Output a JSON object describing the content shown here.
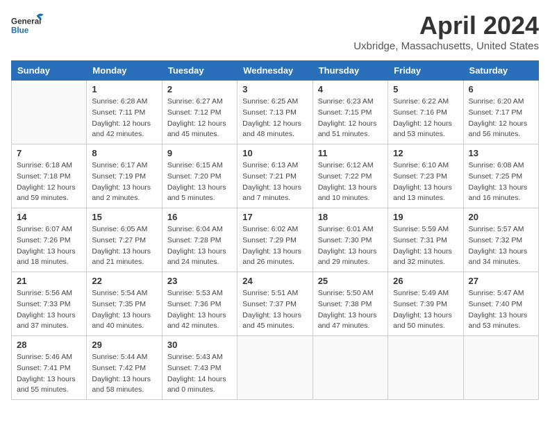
{
  "header": {
    "logo_general": "General",
    "logo_blue": "Blue",
    "month": "April 2024",
    "location": "Uxbridge, Massachusetts, United States"
  },
  "weekdays": [
    "Sunday",
    "Monday",
    "Tuesday",
    "Wednesday",
    "Thursday",
    "Friday",
    "Saturday"
  ],
  "weeks": [
    [
      {
        "day": "",
        "sunrise": "",
        "sunset": "",
        "daylight": ""
      },
      {
        "day": "1",
        "sunrise": "Sunrise: 6:28 AM",
        "sunset": "Sunset: 7:11 PM",
        "daylight": "Daylight: 12 hours and 42 minutes."
      },
      {
        "day": "2",
        "sunrise": "Sunrise: 6:27 AM",
        "sunset": "Sunset: 7:12 PM",
        "daylight": "Daylight: 12 hours and 45 minutes."
      },
      {
        "day": "3",
        "sunrise": "Sunrise: 6:25 AM",
        "sunset": "Sunset: 7:13 PM",
        "daylight": "Daylight: 12 hours and 48 minutes."
      },
      {
        "day": "4",
        "sunrise": "Sunrise: 6:23 AM",
        "sunset": "Sunset: 7:15 PM",
        "daylight": "Daylight: 12 hours and 51 minutes."
      },
      {
        "day": "5",
        "sunrise": "Sunrise: 6:22 AM",
        "sunset": "Sunset: 7:16 PM",
        "daylight": "Daylight: 12 hours and 53 minutes."
      },
      {
        "day": "6",
        "sunrise": "Sunrise: 6:20 AM",
        "sunset": "Sunset: 7:17 PM",
        "daylight": "Daylight: 12 hours and 56 minutes."
      }
    ],
    [
      {
        "day": "7",
        "sunrise": "Sunrise: 6:18 AM",
        "sunset": "Sunset: 7:18 PM",
        "daylight": "Daylight: 12 hours and 59 minutes."
      },
      {
        "day": "8",
        "sunrise": "Sunrise: 6:17 AM",
        "sunset": "Sunset: 7:19 PM",
        "daylight": "Daylight: 13 hours and 2 minutes."
      },
      {
        "day": "9",
        "sunrise": "Sunrise: 6:15 AM",
        "sunset": "Sunset: 7:20 PM",
        "daylight": "Daylight: 13 hours and 5 minutes."
      },
      {
        "day": "10",
        "sunrise": "Sunrise: 6:13 AM",
        "sunset": "Sunset: 7:21 PM",
        "daylight": "Daylight: 13 hours and 7 minutes."
      },
      {
        "day": "11",
        "sunrise": "Sunrise: 6:12 AM",
        "sunset": "Sunset: 7:22 PM",
        "daylight": "Daylight: 13 hours and 10 minutes."
      },
      {
        "day": "12",
        "sunrise": "Sunrise: 6:10 AM",
        "sunset": "Sunset: 7:23 PM",
        "daylight": "Daylight: 13 hours and 13 minutes."
      },
      {
        "day": "13",
        "sunrise": "Sunrise: 6:08 AM",
        "sunset": "Sunset: 7:25 PM",
        "daylight": "Daylight: 13 hours and 16 minutes."
      }
    ],
    [
      {
        "day": "14",
        "sunrise": "Sunrise: 6:07 AM",
        "sunset": "Sunset: 7:26 PM",
        "daylight": "Daylight: 13 hours and 18 minutes."
      },
      {
        "day": "15",
        "sunrise": "Sunrise: 6:05 AM",
        "sunset": "Sunset: 7:27 PM",
        "daylight": "Daylight: 13 hours and 21 minutes."
      },
      {
        "day": "16",
        "sunrise": "Sunrise: 6:04 AM",
        "sunset": "Sunset: 7:28 PM",
        "daylight": "Daylight: 13 hours and 24 minutes."
      },
      {
        "day": "17",
        "sunrise": "Sunrise: 6:02 AM",
        "sunset": "Sunset: 7:29 PM",
        "daylight": "Daylight: 13 hours and 26 minutes."
      },
      {
        "day": "18",
        "sunrise": "Sunrise: 6:01 AM",
        "sunset": "Sunset: 7:30 PM",
        "daylight": "Daylight: 13 hours and 29 minutes."
      },
      {
        "day": "19",
        "sunrise": "Sunrise: 5:59 AM",
        "sunset": "Sunset: 7:31 PM",
        "daylight": "Daylight: 13 hours and 32 minutes."
      },
      {
        "day": "20",
        "sunrise": "Sunrise: 5:57 AM",
        "sunset": "Sunset: 7:32 PM",
        "daylight": "Daylight: 13 hours and 34 minutes."
      }
    ],
    [
      {
        "day": "21",
        "sunrise": "Sunrise: 5:56 AM",
        "sunset": "Sunset: 7:33 PM",
        "daylight": "Daylight: 13 hours and 37 minutes."
      },
      {
        "day": "22",
        "sunrise": "Sunrise: 5:54 AM",
        "sunset": "Sunset: 7:35 PM",
        "daylight": "Daylight: 13 hours and 40 minutes."
      },
      {
        "day": "23",
        "sunrise": "Sunrise: 5:53 AM",
        "sunset": "Sunset: 7:36 PM",
        "daylight": "Daylight: 13 hours and 42 minutes."
      },
      {
        "day": "24",
        "sunrise": "Sunrise: 5:51 AM",
        "sunset": "Sunset: 7:37 PM",
        "daylight": "Daylight: 13 hours and 45 minutes."
      },
      {
        "day": "25",
        "sunrise": "Sunrise: 5:50 AM",
        "sunset": "Sunset: 7:38 PM",
        "daylight": "Daylight: 13 hours and 47 minutes."
      },
      {
        "day": "26",
        "sunrise": "Sunrise: 5:49 AM",
        "sunset": "Sunset: 7:39 PM",
        "daylight": "Daylight: 13 hours and 50 minutes."
      },
      {
        "day": "27",
        "sunrise": "Sunrise: 5:47 AM",
        "sunset": "Sunset: 7:40 PM",
        "daylight": "Daylight: 13 hours and 53 minutes."
      }
    ],
    [
      {
        "day": "28",
        "sunrise": "Sunrise: 5:46 AM",
        "sunset": "Sunset: 7:41 PM",
        "daylight": "Daylight: 13 hours and 55 minutes."
      },
      {
        "day": "29",
        "sunrise": "Sunrise: 5:44 AM",
        "sunset": "Sunset: 7:42 PM",
        "daylight": "Daylight: 13 hours and 58 minutes."
      },
      {
        "day": "30",
        "sunrise": "Sunrise: 5:43 AM",
        "sunset": "Sunset: 7:43 PM",
        "daylight": "Daylight: 14 hours and 0 minutes."
      },
      {
        "day": "",
        "sunrise": "",
        "sunset": "",
        "daylight": ""
      },
      {
        "day": "",
        "sunrise": "",
        "sunset": "",
        "daylight": ""
      },
      {
        "day": "",
        "sunrise": "",
        "sunset": "",
        "daylight": ""
      },
      {
        "day": "",
        "sunrise": "",
        "sunset": "",
        "daylight": ""
      }
    ]
  ]
}
